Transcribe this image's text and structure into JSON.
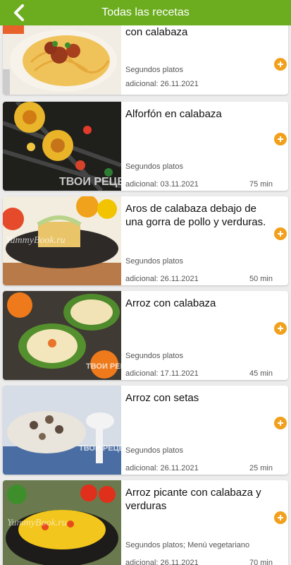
{
  "header": {
    "title": "Todas las recetas"
  },
  "recipes": [
    {
      "title": "con calabaza",
      "category": "Segundos platos",
      "date": "adicional: 26.11.2021",
      "time": ""
    },
    {
      "title": "Alforfón en calabaza",
      "category": "Segundos platos",
      "date": "adicional: 03.11.2021",
      "time": "75 min",
      "watermark": "ТВОИ РЕЦЕПТЫ"
    },
    {
      "title": "Aros de calabaza debajo de una gorra de pollo y verduras.",
      "category": "Segundos platos",
      "date": "adicional: 26.11.2021",
      "time": "50 min",
      "watermark": "YummyBook.ru"
    },
    {
      "title": "Arroz con calabaza",
      "category": "Segundos platos",
      "date": "adicional: 17.11.2021",
      "time": "45 min",
      "watermark": "ТВОИ РЕЦЕПТЫ"
    },
    {
      "title": "Arroz con setas",
      "category": "Segundos platos",
      "date": "adicional: 26.11.2021",
      "time": "25 min",
      "watermark": "ТВОИ РЕЦЕПТЫ"
    },
    {
      "title": "Arroz picante con calabaza y verduras",
      "category": "Segundos platos; Menú vegetariano",
      "date": "adicional: 26.11.2021",
      "time": "70 min",
      "watermark": "YummyBook.ru"
    }
  ],
  "colors": {
    "accent": "#6cad1f",
    "add_button": "#f2a01c"
  },
  "icons": {
    "back": "chevron-left-icon",
    "add": "plus-icon"
  }
}
